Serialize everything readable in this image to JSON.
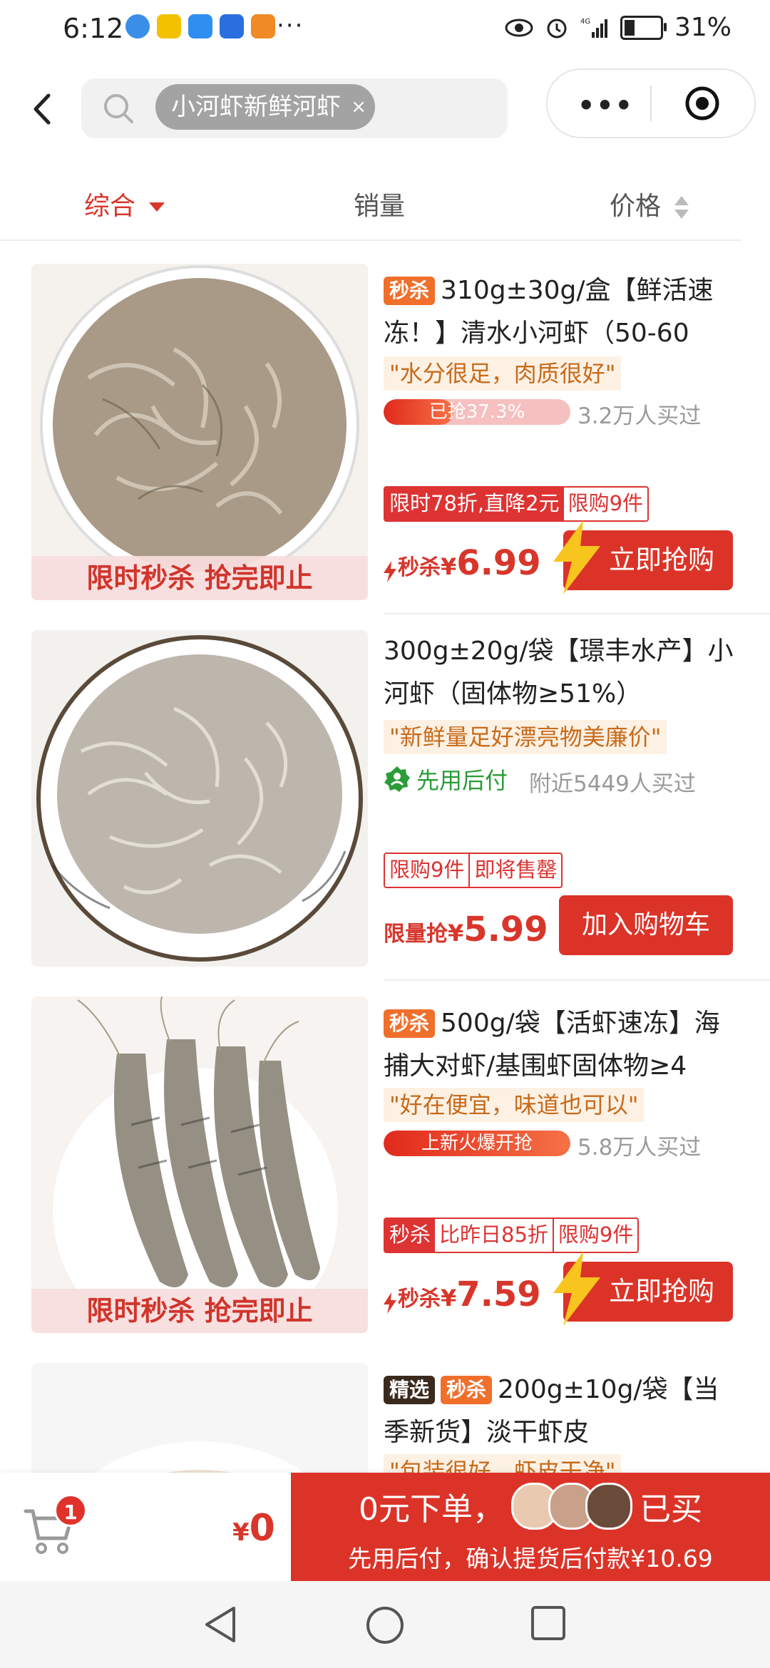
{
  "status_bar": {
    "time": "6:12",
    "more": "···",
    "battery": "31%"
  },
  "search": {
    "chip_text": "小河虾新鲜河虾",
    "chip_close": "×"
  },
  "capsule": {
    "more": "•••"
  },
  "sort": {
    "tabs": [
      "综合",
      "销量",
      "价格"
    ]
  },
  "colors": {
    "accent": "#d8362b",
    "orange_badge": "#f06f2b",
    "green_pay": "#2a9d36"
  },
  "products": [
    {
      "badges": [
        "秒杀"
      ],
      "title": "310g±30g/盒【鲜活速冻！】清水小河虾（50-60",
      "quote": "\"水分很足，肉质很好\"",
      "progress_text": "已抢37.3%",
      "progress_value": 0.373,
      "bought": "3.2万人买过",
      "tags": [
        "限时78折,直降2元",
        "限购9件"
      ],
      "price_label": "秒杀",
      "price_yen": "¥",
      "price": "6.99",
      "button": "立即抢购",
      "image_banner": "限时秒杀  抢完即止"
    },
    {
      "title": "300g±20g/袋【璟丰水产】小河虾（固体物≥51%）",
      "quote": "\"新鲜量足好漂亮物美廉价\"",
      "pay_later": "先用后付",
      "bought": "附近5449人买过",
      "tags": [
        "限购9件",
        "即将售罄"
      ],
      "price_label": "限量抢",
      "price_yen": "¥",
      "price": "5.99",
      "button": "加入购物车"
    },
    {
      "badges": [
        "秒杀"
      ],
      "title": "500g/袋【活虾速冻】海捕大对虾/基围虾固体物≥4",
      "quote": "\"好在便宜，味道也可以\"",
      "progress_text": "上新火爆开抢",
      "progress_value": 1.0,
      "bought": "5.8万人买过",
      "tags": [
        "秒杀",
        "比昨日85折",
        "限购9件"
      ],
      "price_label": "秒杀",
      "price_yen": "¥",
      "price": "7.59",
      "button": "立即抢购",
      "image_banner": "限时秒杀  抢完即止"
    },
    {
      "badges": [
        "精选",
        "秒杀"
      ],
      "title": "200g±10g/袋【当季新货】淡干虾皮",
      "quote": "\"包装很好，虾皮干净\""
    }
  ],
  "bottom_bar": {
    "cart_count": "1",
    "total_yen": "¥",
    "total": "0",
    "order_line1_prefix": "0元下单，",
    "order_line1_suffix": "已买",
    "order_line2": "先用后付，确认提货后付款¥10.69"
  }
}
